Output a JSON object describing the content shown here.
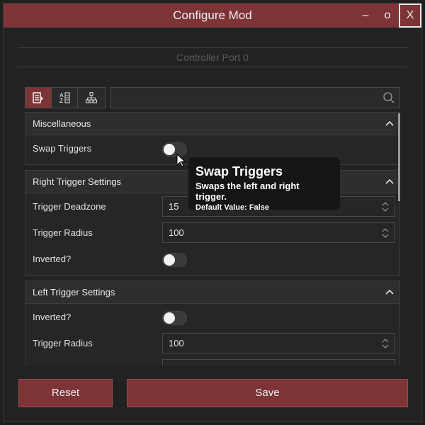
{
  "window": {
    "title": "Configure Mod",
    "minimize_glyph": "–",
    "maximize_glyph": "o",
    "close_glyph": "X"
  },
  "port_title": "Controller Port 0",
  "toolbar": {
    "buttons": [
      {
        "icon": "categorized-icon",
        "active": true
      },
      {
        "icon": "sort-alphabetical-icon",
        "active": false
      },
      {
        "icon": "hierarchy-icon",
        "active": false
      }
    ]
  },
  "search": {
    "placeholder": "",
    "value": "",
    "icon": "search-icon"
  },
  "groups": [
    {
      "title": "Miscellaneous",
      "rows": [
        {
          "label": "Swap Triggers",
          "type": "toggle",
          "value": false
        }
      ]
    },
    {
      "title": "Right Trigger Settings",
      "rows": [
        {
          "label": "Trigger Deadzone",
          "type": "number",
          "value": "15"
        },
        {
          "label": "Trigger Radius",
          "type": "number",
          "value": "100"
        },
        {
          "label": "Inverted?",
          "type": "toggle",
          "value": false
        }
      ]
    },
    {
      "title": "Left Trigger Settings",
      "rows": [
        {
          "label": "Inverted?",
          "type": "toggle",
          "value": false
        },
        {
          "label": "Trigger Radius",
          "type": "number",
          "value": "100"
        }
      ]
    }
  ],
  "tooltip": {
    "title": "Swap Triggers",
    "description": "Swaps the left and right trigger.",
    "default_label": "Default Value:",
    "default_value": "False"
  },
  "footer": {
    "reset_label": "Reset",
    "save_label": "Save"
  },
  "colors": {
    "accent": "#7d3436",
    "background": "#222222",
    "panel": "#262626"
  }
}
